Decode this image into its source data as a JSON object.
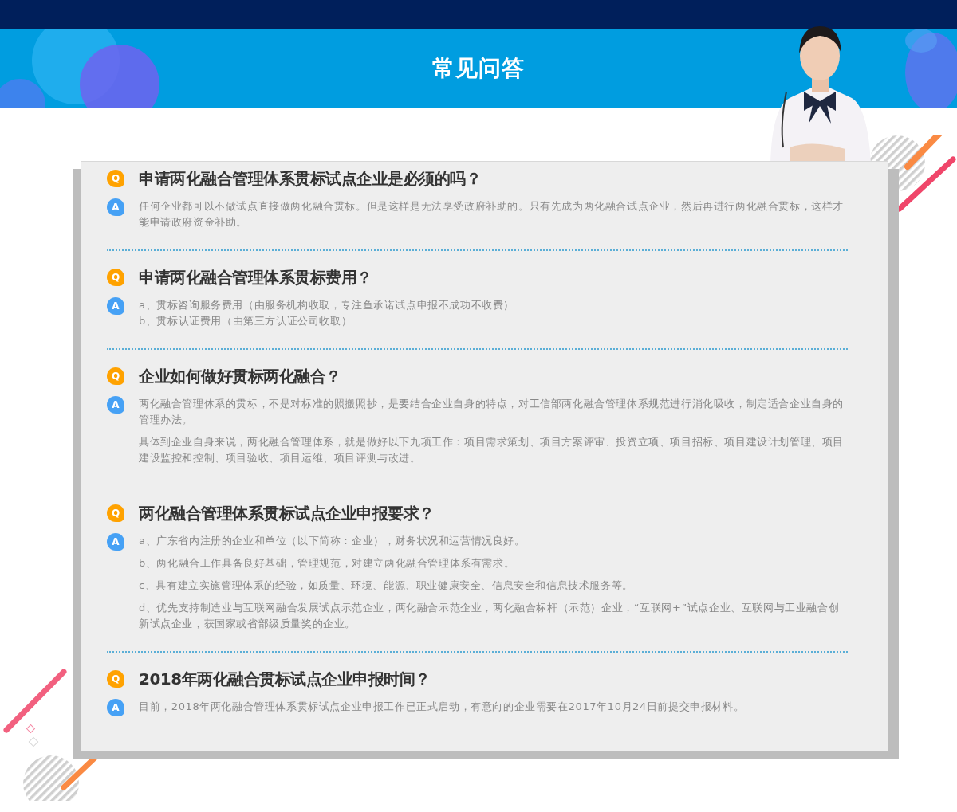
{
  "header": {
    "title": "常见问答"
  },
  "faqs": [
    {
      "q_mark": "Q",
      "a_mark": "A",
      "question": "申请两化融合管理体系贯标试点企业是必须的吗？",
      "divider": true,
      "answers": [
        "任何企业都可以不做试点直接做两化融合贯标。但是这样是无法享受政府补助的。只有先成为两化融合试点企业，然后再进行两化融合贯标，这样才能申请政府资金补助。"
      ]
    },
    {
      "q_mark": "Q",
      "a_mark": "A",
      "question": "申请两化融合管理体系贯标费用？",
      "spaced": false,
      "divider": true,
      "answers": [
        "a、贯标咨询服务费用（由服务机构收取，专注鱼承诺试点申报不成功不收费）",
        "b、贯标认证费用（由第三方认证公司收取）"
      ]
    },
    {
      "q_mark": "Q",
      "a_mark": "A",
      "question": "企业如何做好贯标两化融合？",
      "spaced": true,
      "divider": false,
      "answers": [
        "两化融合管理体系的贯标，不是对标准的照搬照抄，是要结合企业自身的特点，对工信部两化融合管理体系规范进行消化吸收，制定适合企业自身的管理办法。",
        "具体到企业自身来说，两化融合管理体系，就是做好以下九项工作：项目需求策划、项目方案评审、投资立项、项目招标、项目建设计划管理、项目建设监控和控制、项目验收、项目运维、项目评测与改进。"
      ]
    },
    {
      "q_mark": "Q",
      "a_mark": "A",
      "question": "两化融合管理体系贯标试点企业申报要求？",
      "spaced": true,
      "divider": true,
      "answers": [
        "a、广东省内注册的企业和单位（以下简称：企业），财务状况和运营情况良好。",
        "b、两化融合工作具备良好基础，管理规范，对建立两化融合管理体系有需求。",
        "c、具有建立实施管理体系的经验，如质量、环境、能源、职业健康安全、信息安全和信息技术服务等。",
        "d、优先支持制造业与互联网融合发展试点示范企业，两化融合示范企业，两化融合标杆（示范）企业，“互联网+”试点企业、互联网与工业融合创新试点企业，获国家或省部级质量奖的企业。"
      ]
    },
    {
      "q_mark": "Q",
      "a_mark": "A",
      "question": "2018年两化融合贯标试点企业申报时间？",
      "divider": false,
      "answers": [
        "目前，2018年两化融合管理体系贯标试点企业申报工作已正式启动，有意向的企业需要在2017年10月24日前提交申报材料。"
      ]
    }
  ]
}
